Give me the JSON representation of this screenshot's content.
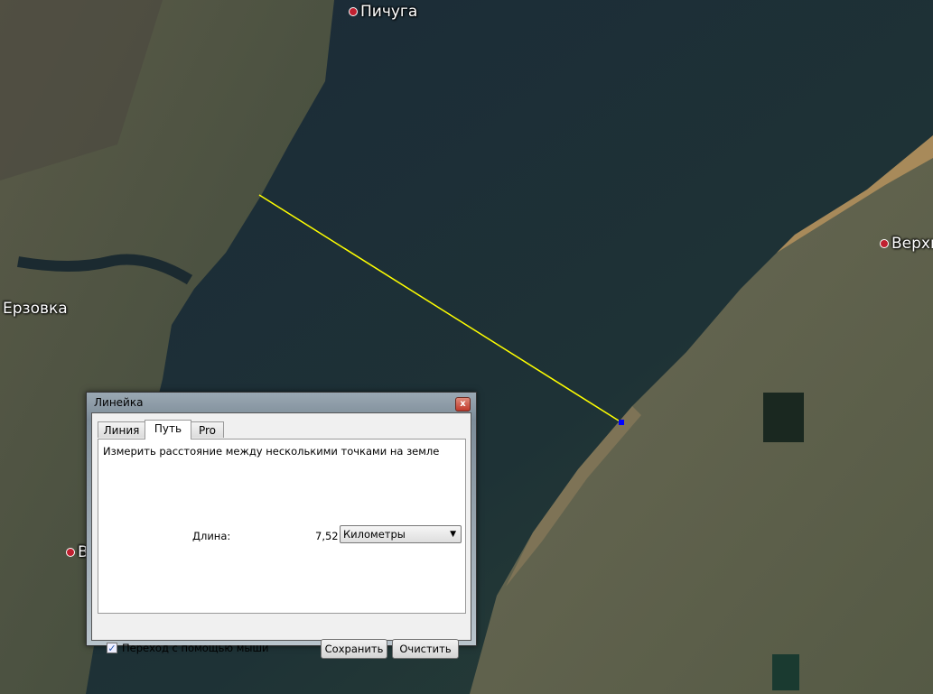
{
  "map": {
    "places": [
      {
        "name": "Пичуга"
      },
      {
        "name": "Ерзовка"
      },
      {
        "name": "Верхн"
      },
      {
        "name": "В"
      }
    ],
    "path_color": "#ffff00",
    "endpoint_color": "#0000ff"
  },
  "dialog": {
    "title": "Линейка",
    "close": "x",
    "tabs": [
      "Линия",
      "Путь",
      "Pro"
    ],
    "active_tab": "Путь",
    "description": "Измерить расстояние между несколькими точками на земле",
    "length_label": "Длина:",
    "length_value": "7,52",
    "unit": "Километры",
    "mouse_nav_checked": true,
    "mouse_nav_label": "Переход с помощью мыши",
    "save": "Сохранить",
    "clear": "Очистить"
  }
}
